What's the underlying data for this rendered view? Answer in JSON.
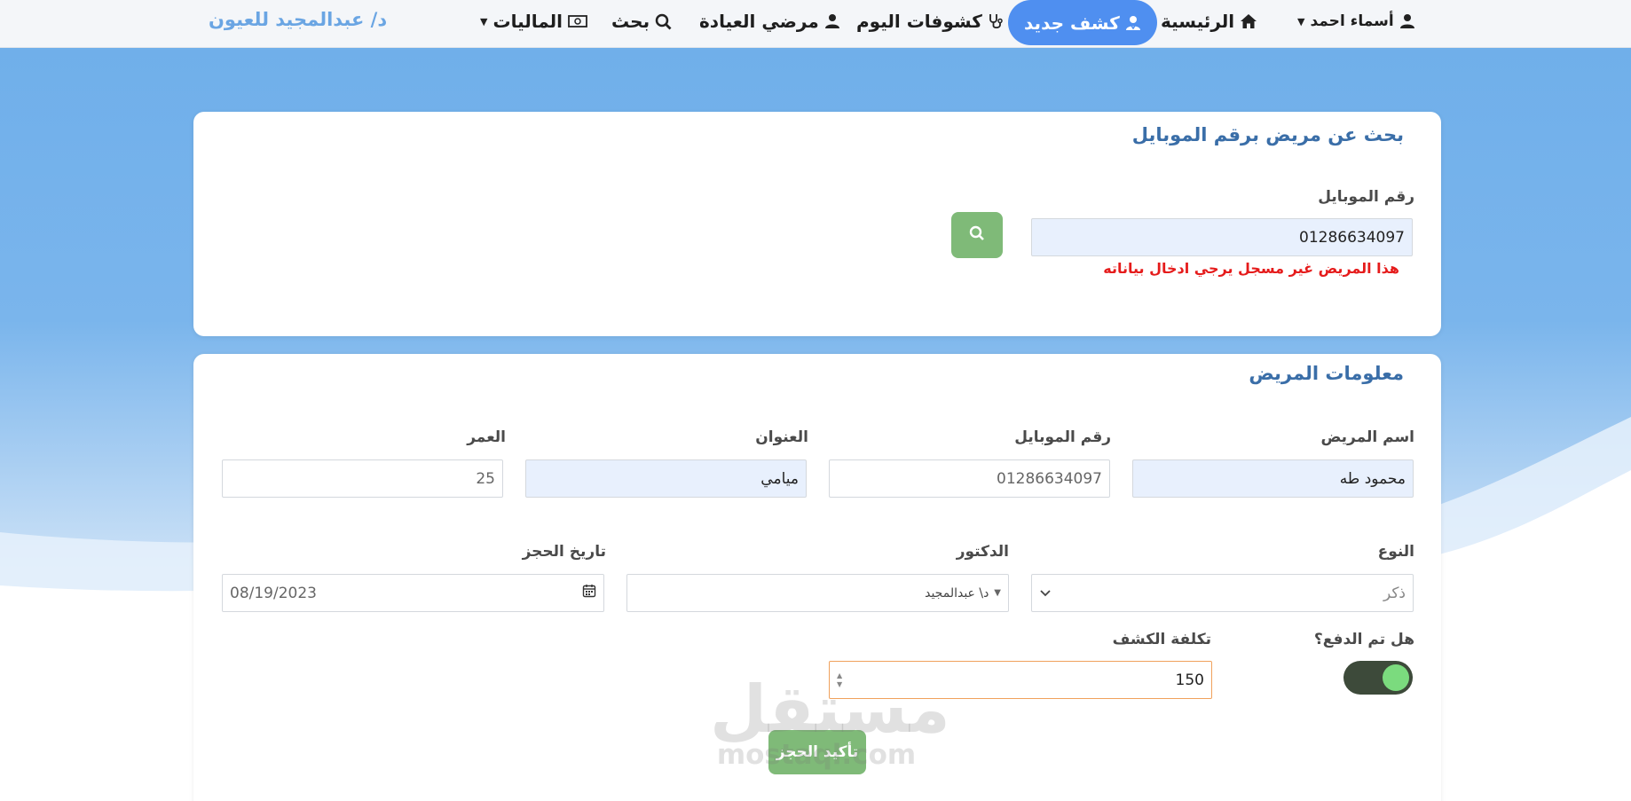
{
  "navbar": {
    "user_menu": "أسماء احمد",
    "home": "الرئيسية",
    "new_exam": "كشف جديد",
    "today_exams": "كشوفات اليوم",
    "clinic_patients": "مرضي العيادة",
    "search": "بحث",
    "finance": "الماليات",
    "brand": "د/ عبدالمجيد للعيون",
    "active_color": "#4f8ff0"
  },
  "search_card": {
    "title": "بحث عن مريض برقم الموبايل",
    "mobile_label": "رقم الموبايل",
    "mobile_value": "01286634097",
    "error_message": "هذا المريض غير مسجل يرجي ادخال بياناته",
    "error_color": "#e51b1b"
  },
  "patient_card": {
    "title": "معلومات المريض",
    "name_label": "اسم المريض",
    "name_value": "محمود طه",
    "mobile_label": "رقم الموبايل",
    "mobile_value": "01286634097",
    "address_label": "العنوان",
    "address_value": "ميامي",
    "age_label": "العمر",
    "age_value": "25",
    "gender_label": "النوع",
    "gender_value": "ذكر",
    "doctor_label": "الدكتور",
    "doctor_value": "د\\ عبدالمجيد",
    "date_label": "تاريخ الحجز",
    "date_value": "08/19/2023",
    "paid_label": "هل تم الدفع؟",
    "paid_on": true,
    "cost_label": "تكلفة الكشف",
    "cost_value": "150",
    "confirm_button": "تأكيد الحجز"
  },
  "watermark": {
    "arabic": "مستقل",
    "latin": "mostaql.com"
  },
  "icons": {
    "user": "user-icon",
    "home": "home-icon",
    "user_md": "user-md-icon",
    "stethoscope": "stethoscope-icon",
    "search": "search-icon",
    "money": "money-icon",
    "calendar": "calendar-icon"
  }
}
